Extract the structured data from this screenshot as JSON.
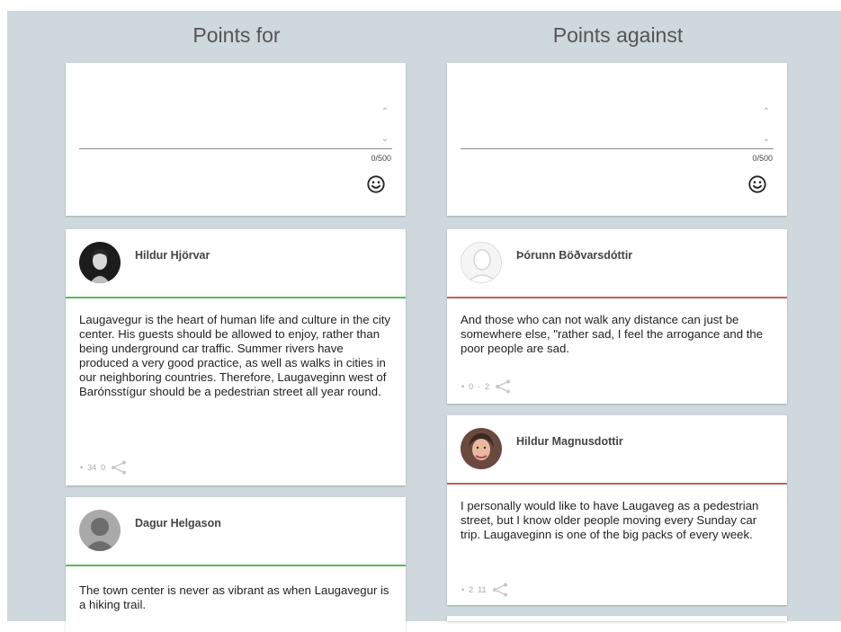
{
  "columns": {
    "for": {
      "title": "Points for"
    },
    "against": {
      "title": "Points against"
    }
  },
  "composer": {
    "counter": "0/500",
    "emoji_icon": "smiley-icon"
  },
  "posts_for": [
    {
      "author": "Hildur Hjörvar",
      "text": "Laugavegur is the heart of human life and culture in the city center. His guests should be allowed to enjoy, rather than being underground car traffic. Summer rivers have produced a very good practice, as well as walks in cities in our neighboring countries. Therefore, Laugaveginn west of Barónsstígur should be a pedestrian street all year round.",
      "up": "34",
      "down": "0"
    },
    {
      "author": "Dagur Helgason",
      "text": "The town center is never as vibrant as when Laugavegur is a hiking trail."
    }
  ],
  "posts_against": [
    {
      "author": "Þórunn Böðvarsdóttir",
      "text": "And those who can not walk any distance can just be somewhere else, \"rather sad, I feel the arrogance and the poor people are sad.",
      "up": "0",
      "down": "2"
    },
    {
      "author": "Hildur Magnusdottir",
      "text": "I personally would like to have Laugaveg as a pedestrian street, but I know older people moving every Sunday car trip. Laugaveginn is one of the big packs of every week.",
      "up": "2",
      "down": "11"
    }
  ],
  "colors": {
    "background": "#cfd8dc",
    "for_accent": "#5cb85c",
    "against_accent": "#c0605e"
  }
}
